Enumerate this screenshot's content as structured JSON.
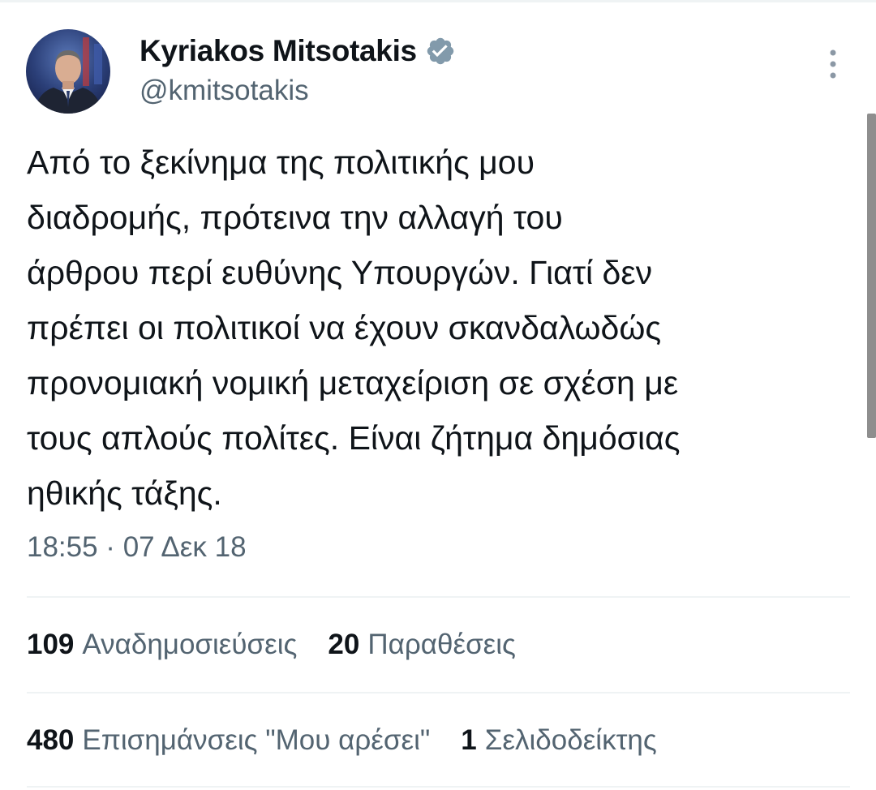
{
  "tweet": {
    "author": {
      "display_name": "Kyriakos Mitsotakis",
      "handle": "@kmitsotakis",
      "verified": true,
      "verified_color": "#829aab"
    },
    "text_lines": [
      "Από το ξεκίνημα της πολιτικής μου",
      "διαδρομής, πρότεινα την αλλαγή του",
      "άρθρου περί ευθύνης Υπουργών. Γιατί δεν",
      "πρέπει οι πολιτικοί να έχουν σκανδαλωδώς",
      "προνομιακή νομική μεταχείριση σε σχέση με",
      "τους απλούς πολίτες. Είναι ζήτημα δημόσιας",
      "ηθικής τάξης."
    ],
    "timestamp": "18:55 · 07 Δεκ 18",
    "stats": {
      "reposts": {
        "count": "109",
        "label": "Αναδημοσιεύσεις"
      },
      "quotes": {
        "count": "20",
        "label": "Παραθέσεις"
      },
      "likes": {
        "count": "480",
        "label": "Επισημάνσεις \"Μου αρέσει\""
      },
      "bookmarks": {
        "count": "1",
        "label": "Σελιδοδείκτης"
      }
    }
  },
  "icons": {
    "verified": "verified-badge-icon",
    "more": "more-vertical-icon"
  },
  "colors": {
    "text_primary": "#0f1419",
    "text_secondary": "#536471",
    "divider": "#eff3f4"
  }
}
